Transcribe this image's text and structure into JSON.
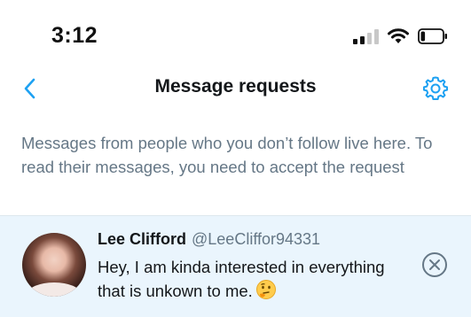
{
  "status_bar": {
    "time": "3:12",
    "signal_icon": "cellular-signal-icon",
    "wifi_icon": "wifi-icon",
    "battery_icon": "battery-icon",
    "battery_level": 0.2
  },
  "nav": {
    "back_icon": "chevron-left-icon",
    "title": "Message requests",
    "settings_icon": "gear-icon"
  },
  "info_text": "Messages from people who you don’t follow live here. To read their messages, you need to accept the request",
  "requests": [
    {
      "name": "Lee Clifford",
      "handle": "@LeeCliffor94331",
      "message": "Hey, I am kinda interested in everything that is unkown to me.",
      "emoji_icon": "thinking-face-icon",
      "dismiss_icon": "close-circle-icon"
    }
  ],
  "colors": {
    "accent": "#1da1f2",
    "secondary_text": "#657786",
    "highlight_row": "#eaf5fd"
  }
}
